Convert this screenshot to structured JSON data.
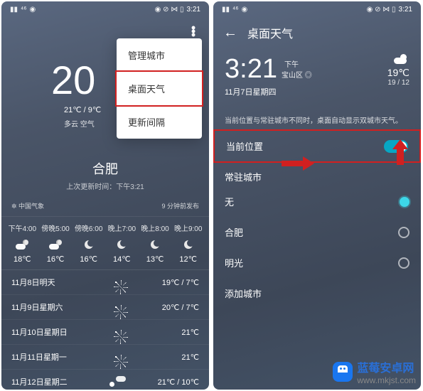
{
  "status": {
    "carrier": "⁴⁶",
    "time": "3:21",
    "icons_right": "◉ ⊘ ⋈ ▯"
  },
  "left": {
    "big_temp": "20",
    "temp_range": "21℃ / 9℃",
    "condition": "多云  空气",
    "menu": {
      "manage_city": "管理城市",
      "desktop_weather": "桌面天气",
      "update_interval": "更新间隔"
    },
    "city": "合肥",
    "last_update": "上次更新时间：下午3:21",
    "meta_left": "中国气象",
    "meta_right": "9 分钟前发布",
    "hourly": [
      {
        "time": "下午4:00",
        "icon": "cloud",
        "temp": "18℃"
      },
      {
        "time": "傍晚5:00",
        "icon": "cloud",
        "temp": "16℃"
      },
      {
        "time": "傍晚6:00",
        "icon": "moon",
        "temp": "16℃"
      },
      {
        "time": "晚上7:00",
        "icon": "moon",
        "temp": "14℃"
      },
      {
        "time": "晚上8:00",
        "icon": "moon",
        "temp": "13℃"
      },
      {
        "time": "晚上9:00",
        "icon": "moon",
        "temp": "12℃"
      }
    ],
    "daily": [
      {
        "date": "11月8日明天",
        "icon": "sun",
        "hi": "19℃",
        "lo": "7℃"
      },
      {
        "date": "11月9日星期六",
        "icon": "sun",
        "hi": "20℃",
        "lo": "7℃"
      },
      {
        "date": "11月10日星期日",
        "icon": "sun",
        "hi": "21℃",
        "lo": ""
      },
      {
        "date": "11月11日星期一",
        "icon": "sun",
        "hi": "21℃",
        "lo": ""
      },
      {
        "date": "11月12日星期二",
        "icon": "cloud",
        "hi": "21℃",
        "lo": "10℃"
      }
    ]
  },
  "right": {
    "title": "桌面天气",
    "time": "3:21",
    "ampm": "下午",
    "location": "宝山区",
    "date": "11月7日星期四",
    "cur_temp": "19℃",
    "range": "19 / 12",
    "note": "当前位置与常驻城市不同时，桌面自动显示双城市天气。",
    "row_current": "当前位置",
    "row_resident": "常驻城市",
    "row_none": "无",
    "row_hefei": "合肥",
    "row_mingguang": "明光",
    "row_add": "添加城市"
  },
  "watermark": {
    "text": "蓝莓安卓网",
    "site": "www.mkjst.com"
  }
}
